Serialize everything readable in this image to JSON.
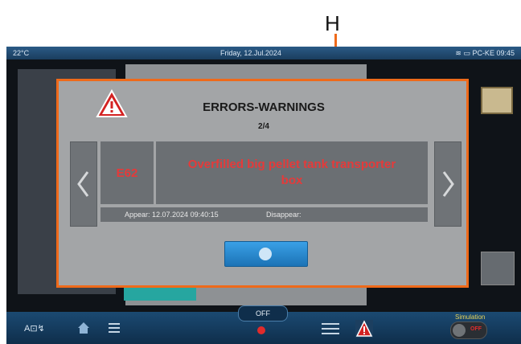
{
  "annotation": {
    "letter": "H"
  },
  "status_bar": {
    "temperature": "22°C",
    "date": "Friday, 12.Jul.2024",
    "device": "PC-KE",
    "time": "09:45"
  },
  "dialog": {
    "title": "ERRORS-WARNINGS",
    "counter": "2/4",
    "error_code": "E62",
    "error_message": "Overfilled big pellet tank transporter box",
    "appear_text": "Appear: 12.07.2024 09:40:15",
    "disappear_label": "Disappear:"
  },
  "bottom_bar": {
    "off_label": "OFF",
    "simulation_label": "Simulation",
    "simulation_toggle": "OFF"
  },
  "colors": {
    "accent_orange": "#ef6a1a",
    "error_red": "#e53a3a",
    "ok_blue": "#2a8ad2"
  }
}
